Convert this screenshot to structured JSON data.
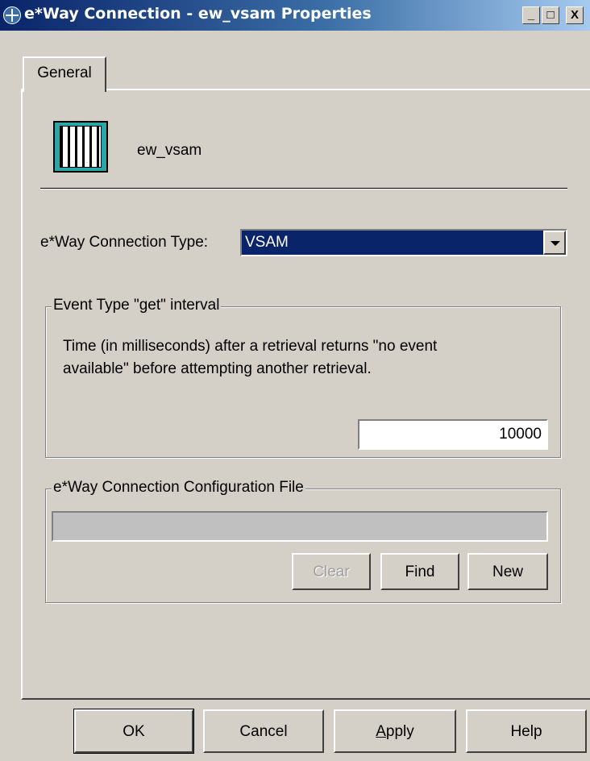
{
  "window": {
    "title": "e*Way Connection - ew_vsam Properties",
    "controls": {
      "minimize": "_",
      "maximize": "□",
      "close": "X"
    }
  },
  "tabs": [
    {
      "label": "General",
      "selected": true
    }
  ],
  "general": {
    "object_icon": "eway-connection-icon",
    "object_name": "ew_vsam",
    "connection_type_label": "e*Way Connection Type:",
    "connection_type_value": "VSAM",
    "interval_group": {
      "legend": "Event Type \"get\" interval",
      "description": "Time (in milliseconds) after a retrieval returns \"no event available\" before attempting another retrieval.",
      "value": "10000"
    },
    "config_group": {
      "legend": "e*Way Connection Configuration File",
      "file_value": "",
      "buttons": {
        "clear": "Clear",
        "find": "Find",
        "new": "New"
      }
    }
  },
  "dialog_buttons": {
    "ok": "OK",
    "cancel": "Cancel",
    "apply_prefix": "",
    "apply_mnemonic": "A",
    "apply_rest": "pply",
    "help": "Help"
  },
  "colors": {
    "face": "#d4d0c8",
    "title_start": "#0a246a",
    "title_end": "#a6caf0",
    "selection": "#0a246a"
  }
}
